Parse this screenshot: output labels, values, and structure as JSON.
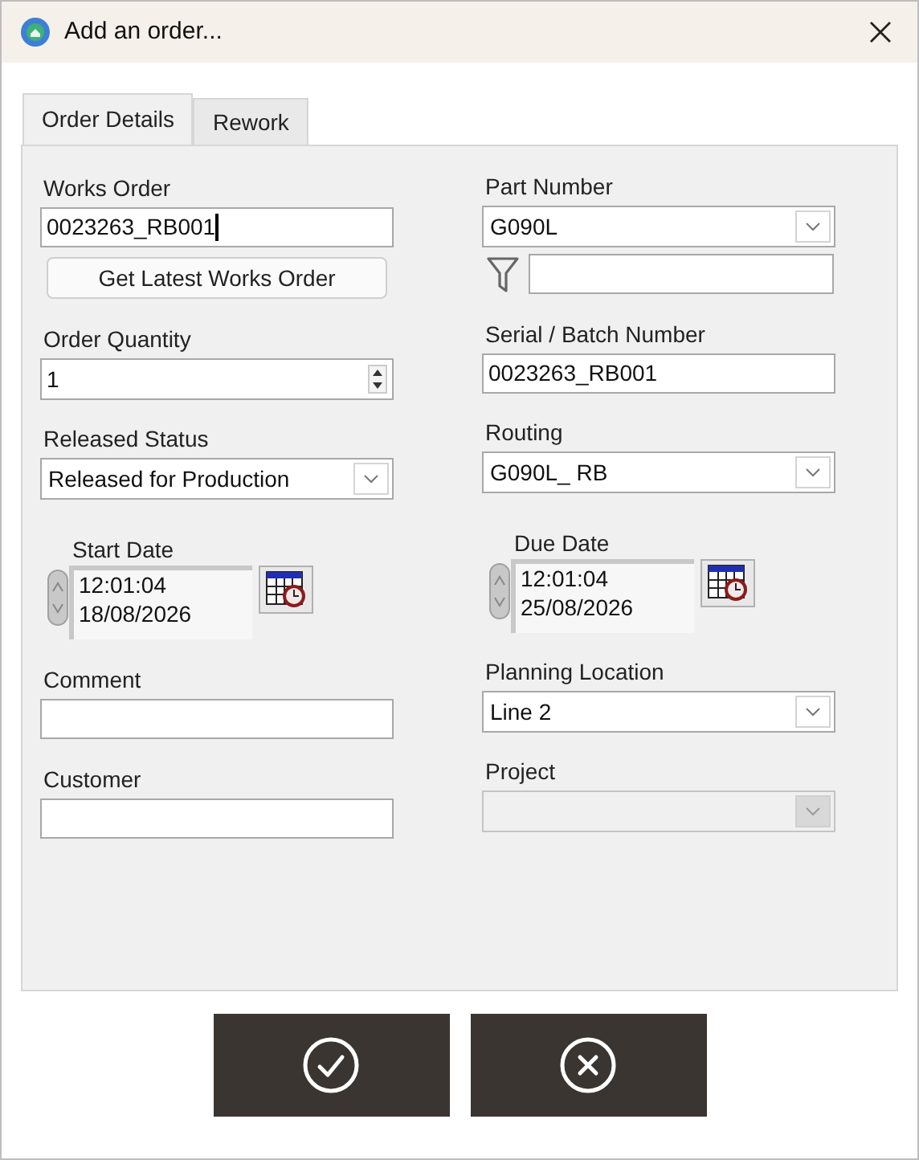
{
  "window": {
    "title": "Add an order..."
  },
  "tabs": [
    {
      "label": "Order Details",
      "selected": true
    },
    {
      "label": "Rework",
      "selected": false
    }
  ],
  "left_fields": [
    {
      "kind": "text",
      "label": "Works Order",
      "value": "0023263_RB001",
      "focused": true
    },
    {
      "kind": "button",
      "label": "Get Latest Works Order"
    },
    {
      "kind": "spinner",
      "label": "Order Quantity",
      "value": "1"
    },
    {
      "kind": "dropdown",
      "label": "Released Status",
      "value": "Released for Production",
      "disabled": false
    },
    {
      "kind": "date",
      "label": "Start Date",
      "time": "12:01:04",
      "date": "18/08/2026"
    },
    {
      "kind": "text",
      "label": "Comment",
      "focused": false
    },
    {
      "kind": "text",
      "label": "Customer",
      "focused": false
    }
  ],
  "right_fields": [
    {
      "kind": "dropdown",
      "label": "Part Number",
      "value": "G090L",
      "disabled": false
    },
    {
      "kind": "filter"
    },
    {
      "kind": "text",
      "label": "Serial / Batch Number",
      "value": "0023263_RB001",
      "focused": false
    },
    {
      "kind": "dropdown",
      "label": "Routing",
      "value": "G090L_ RB",
      "disabled": false
    },
    {
      "kind": "date",
      "label": "Due Date",
      "time": "12:01:04",
      "date": "25/08/2026"
    },
    {
      "kind": "dropdown",
      "label": "Planning Location",
      "value": "Line 2",
      "disabled": false
    },
    {
      "kind": "dropdown",
      "label": "Project",
      "disabled": true
    }
  ],
  "buttons": [
    {
      "kind": "ok"
    },
    {
      "kind": "cancel"
    }
  ]
}
